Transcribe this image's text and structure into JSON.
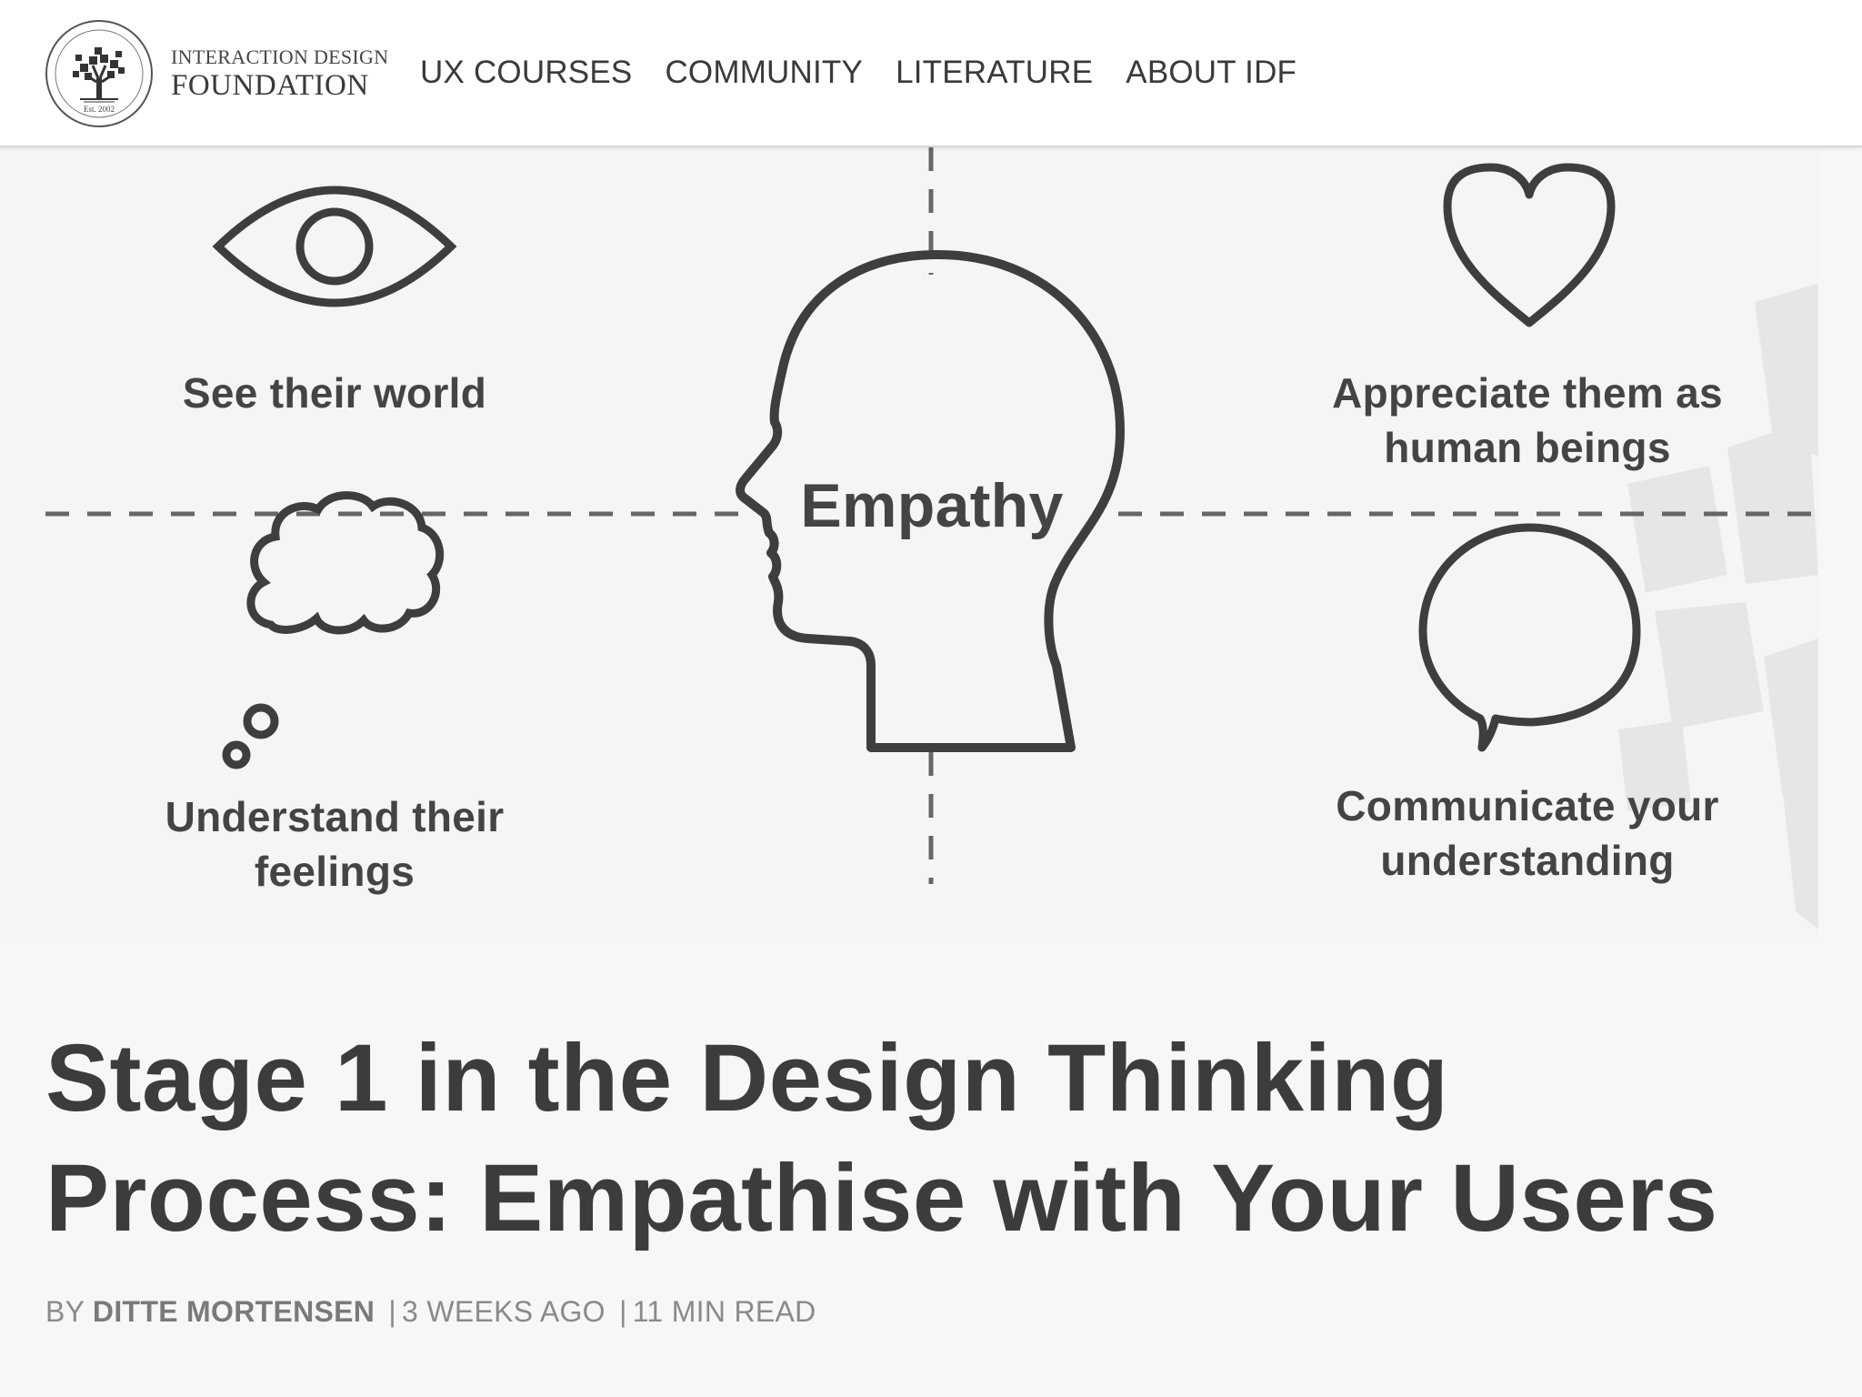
{
  "header": {
    "logo": {
      "line1": "INTERACTION DESIGN",
      "line2": "FOUNDATION",
      "seal_text": "Est. 2002"
    },
    "nav": [
      {
        "label": "UX COURSES"
      },
      {
        "label": "COMMUNITY"
      },
      {
        "label": "LITERATURE"
      },
      {
        "label": "ABOUT IDF"
      }
    ]
  },
  "hero": {
    "center_label": "Empathy",
    "quadrants": {
      "top_left": {
        "line1": "See their world",
        "line2": "",
        "icon": "eye-icon"
      },
      "top_right": {
        "line1": "Appreciate them as",
        "line2": "human beings",
        "icon": "heart-icon"
      },
      "bottom_left": {
        "line1": "Understand their",
        "line2": "feelings",
        "icon": "thought-bubble-icon"
      },
      "bottom_right": {
        "line1": "Communicate your",
        "line2": "understanding",
        "icon": "speech-bubble-icon"
      }
    }
  },
  "article": {
    "title_line1": "Stage 1 in the Design Thinking",
    "title_line2": "Process: Empathise with Your Users",
    "byline": {
      "prefix": "BY",
      "author": "DITTE MORTENSEN",
      "separator": "|",
      "age": "3 WEEKS AGO",
      "read_time": "11 MIN READ"
    }
  },
  "colors": {
    "header_bg": "#ffffff",
    "page_bg": "#f7f7f7",
    "text_dark": "#3c3c3c",
    "byline_gray": "#8a8a8a"
  }
}
